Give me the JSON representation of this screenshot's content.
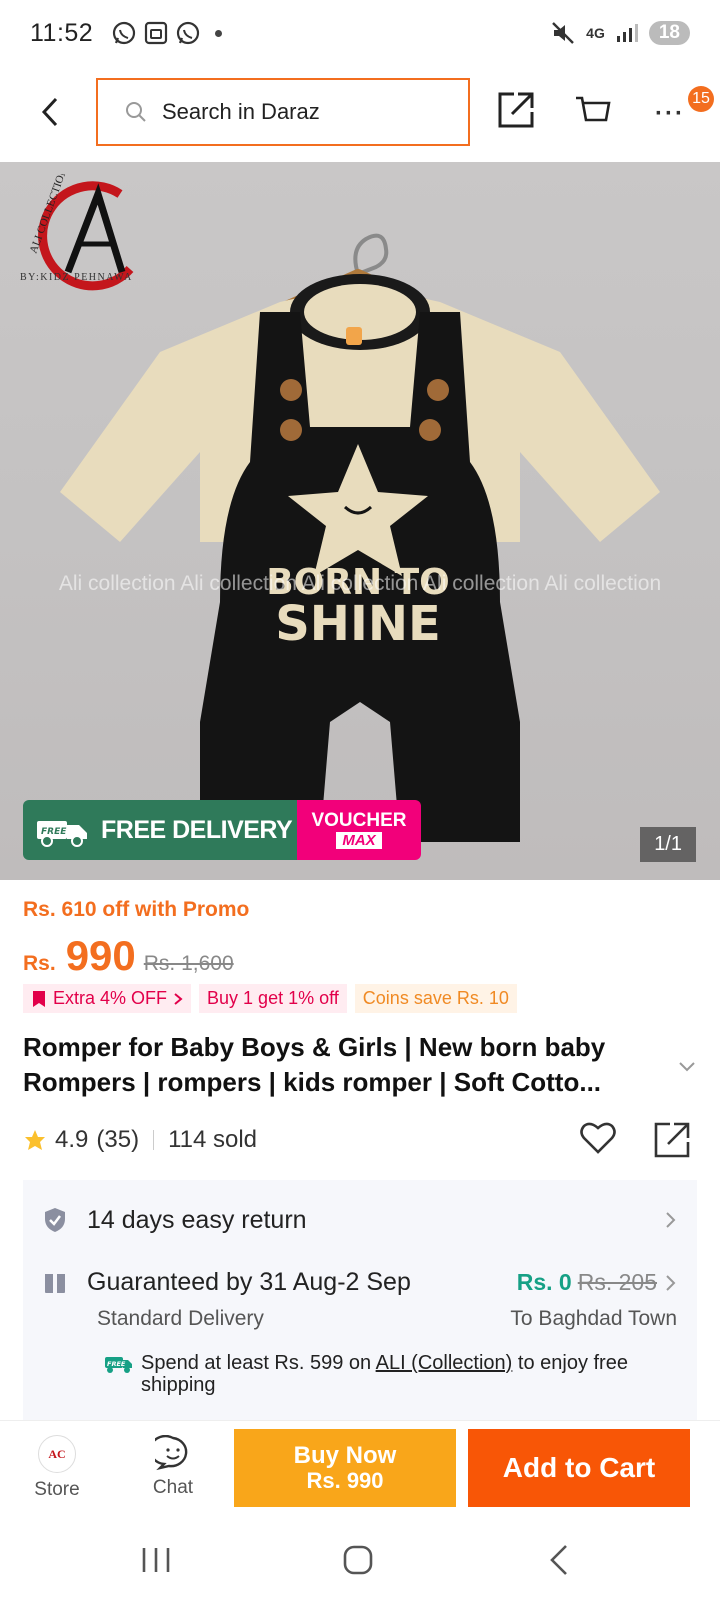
{
  "status_bar": {
    "time": "11:52",
    "network": "4G",
    "battery": "18"
  },
  "nav": {
    "search_placeholder": "Search in Daraz",
    "cart_badge": "15"
  },
  "hero": {
    "brand_name": "ALI COLLECTION",
    "brand_sub": "BY:KIDZ PEHNAWA",
    "watermark": "Ali collection Ali collection Ali collection Ali collection Ali collection",
    "image_counter": "1/1",
    "free_label": "FREE",
    "free_delivery": "FREE DELIVERY",
    "voucher_top": "VOUCHER",
    "voucher_bottom": "MAX",
    "garment_text_line1": "BORN TO",
    "garment_text_line2": "SHINE"
  },
  "price": {
    "promo": "Rs. 610 off with Promo",
    "currency": "Rs.",
    "amount": "990",
    "original": "Rs. 1,600"
  },
  "tags": [
    {
      "label": "Extra 4% OFF"
    },
    {
      "label": "Buy 1 get 1% off"
    },
    {
      "label": "Coins save Rs. 10"
    }
  ],
  "product": {
    "title": "Romper for Baby Boys & Girls | New born baby Rompers | rompers | kids romper | Soft Cotto...",
    "rating": "4.9",
    "review_count": "(35)",
    "sold": "114 sold"
  },
  "info": {
    "return_policy": "14 days easy return",
    "delivery_guarantee": "Guaranteed by 31 Aug-2 Sep",
    "delivery_fee": "Rs. 0",
    "delivery_fee_old": "Rs. 205",
    "delivery_type": "Standard Delivery",
    "destination": "To Baghdad Town",
    "free_ship_prefix": "Spend at least Rs. 599 on",
    "free_ship_store": "ALI (Collection)",
    "free_ship_suffix": "to enjoy free shipping",
    "free_badge": "FREE"
  },
  "bottom_bar": {
    "store_label": "Store",
    "chat_label": "Chat",
    "buy_now_label": "Buy Now",
    "buy_now_price": "Rs. 990",
    "add_to_cart_label": "Add to Cart"
  },
  "colors": {
    "accent": "#f36e1f",
    "buy_now": "#f9a61a",
    "add_to_cart": "#f85606",
    "free_delivery": "#2f7a5a",
    "voucher": "#f2007a",
    "free_shipping_fee": "#16a085"
  }
}
